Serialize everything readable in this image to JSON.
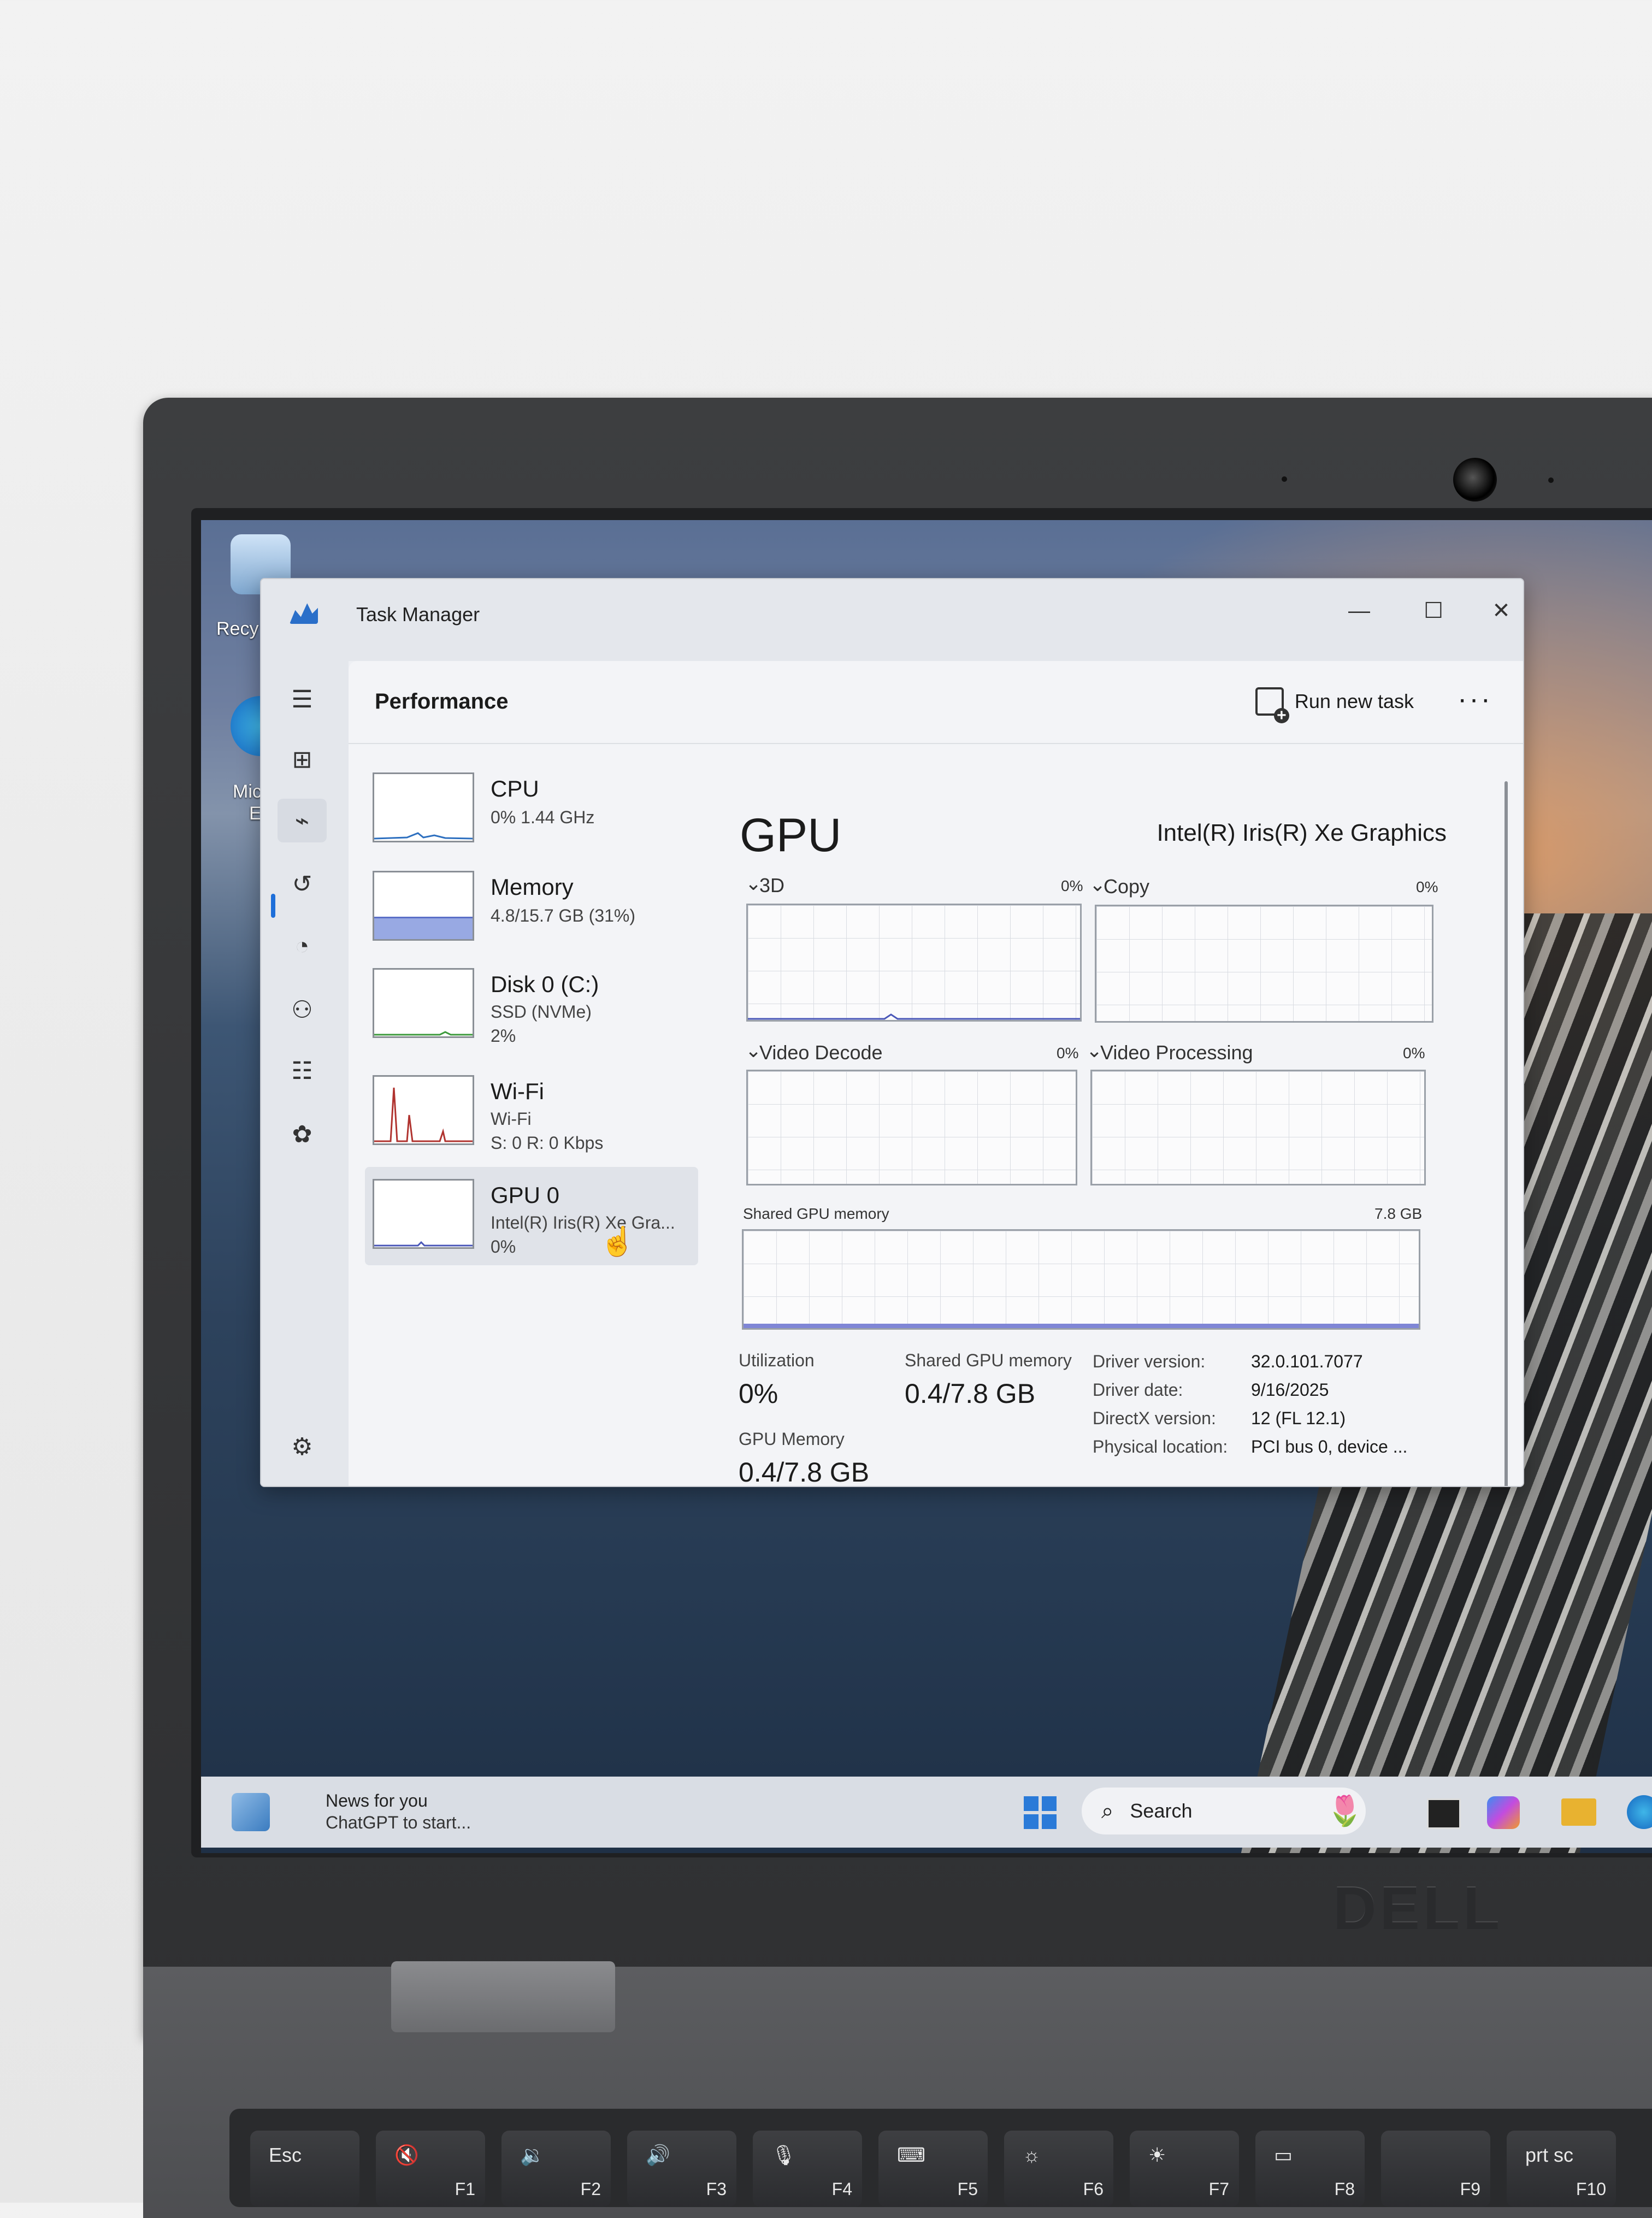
{
  "window": {
    "title": "Task Manager",
    "controls": {
      "minimize": "—",
      "maximize": "☐",
      "close": "✕"
    }
  },
  "header": {
    "title": "Performance",
    "run_new_task": "Run new task",
    "more": "···"
  },
  "nav_icons": [
    "hamburger-icon",
    "processes-icon",
    "performance-icon",
    "app-history-icon",
    "startup-apps-icon",
    "users-icon",
    "details-icon",
    "services-icon",
    "settings-icon"
  ],
  "resources": [
    {
      "name": "CPU",
      "line1": "0%  1.44 GHz",
      "line2": ""
    },
    {
      "name": "Memory",
      "line1": "4.8/15.7 GB (31%)",
      "line2": ""
    },
    {
      "name": "Disk 0 (C:)",
      "line1": "SSD (NVMe)",
      "line2": "2%"
    },
    {
      "name": "Wi-Fi",
      "line1": "Wi-Fi",
      "line2": "S: 0 R: 0 Kbps"
    },
    {
      "name": "GPU 0",
      "line1": "Intel(R) Iris(R) Xe Gra...",
      "line2": "0%"
    }
  ],
  "memory_usage_fraction": 0.31,
  "detail": {
    "title": "GPU",
    "model": "Intel(R) Iris(R) Xe Graphics",
    "graphs": [
      {
        "label": "3D",
        "pct": "0%"
      },
      {
        "label": "Copy",
        "pct": "0%"
      },
      {
        "label": "Video Decode",
        "pct": "0%"
      },
      {
        "label": "Video Processing",
        "pct": "0%"
      }
    ],
    "shared_graph": {
      "label": "Shared GPU memory",
      "max": "7.8 GB"
    },
    "stats": {
      "utilization_label": "Utilization",
      "utilization_value": "0%",
      "shared_label": "Shared GPU memory",
      "shared_value": "0.4/7.8 GB",
      "gpu_memory_label": "GPU Memory",
      "gpu_memory_value": "0.4/7.8 GB"
    },
    "info": [
      {
        "key": "Driver version:",
        "value": "32.0.101.7077"
      },
      {
        "key": "Driver date:",
        "value": "9/16/2025"
      },
      {
        "key": "DirectX version:",
        "value": "12 (FL 12.1)"
      },
      {
        "key": "Physical location:",
        "value": "PCI bus 0, device ..."
      }
    ]
  },
  "taskbar": {
    "news_title": "News for you",
    "news_sub": "ChatGPT to start...",
    "search_label": "Search"
  },
  "desktop": {
    "icon1_label": "Recy",
    "icon2_label": "Micr",
    "icon2_label2": "Ed"
  },
  "brand": "DELL",
  "keys": [
    {
      "main": "Esc",
      "fn": ""
    },
    {
      "main": "🔇",
      "fn": "F1"
    },
    {
      "main": "🔉",
      "fn": "F2"
    },
    {
      "main": "🔊",
      "fn": "F3"
    },
    {
      "main": "🎙",
      "fn": "F4"
    },
    {
      "main": "⌨",
      "fn": "F5"
    },
    {
      "main": "☼",
      "fn": "F6"
    },
    {
      "main": "☀",
      "fn": "F7"
    },
    {
      "main": "▭",
      "fn": "F8"
    },
    {
      "main": "",
      "fn": "F9"
    },
    {
      "main": "prt sc",
      "fn": "F10"
    }
  ]
}
